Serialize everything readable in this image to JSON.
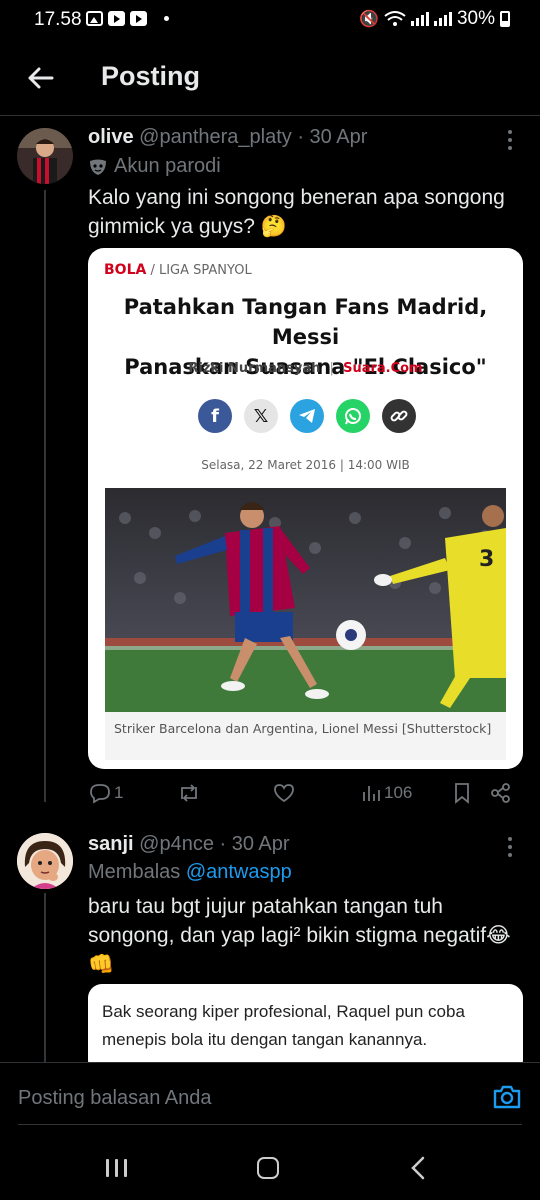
{
  "status_bar": {
    "time": "17.58",
    "battery": "30%"
  },
  "header": {
    "title": "Posting"
  },
  "tweet1": {
    "name": "olive",
    "handle": "@panthera_platy",
    "date": "· 30 Apr",
    "parody_label": "Akun parodi",
    "text": "Kalo yang ini songong beneran apa songong gimmick ya guys? 🤔",
    "card": {
      "section": "BOLA",
      "subsection": "/ LIGA SPANYOL",
      "headline_line1": "Patahkan Tangan Fans Madrid, Messi",
      "headline_line2": "Panaskan Suasana \"El Clasico\"",
      "author": "Rizki Nurmansyah",
      "separator": "|",
      "site": "Suara.Com",
      "dateline": "Selasa, 22 Maret 2016 | 14:00 WIB",
      "caption": "Striker Barcelona dan Argentina, Lionel Messi [Shutterstock]",
      "share_icons": [
        "facebook-icon",
        "x-icon",
        "telegram-icon",
        "whatsapp-icon",
        "link-icon"
      ],
      "colors": {
        "facebook": "#3b5998",
        "x": "#e5e5e5",
        "telegram": "#2aa3e0",
        "whatsapp": "#25d366",
        "link": "#333333"
      }
    },
    "actions": {
      "replies": "1",
      "retweets": "",
      "likes": "",
      "views": "106"
    }
  },
  "tweet2": {
    "name": "sanji",
    "handle": "@p4nce",
    "date": "· 30 Apr",
    "reply_prefix": "Membalas",
    "reply_mention": "@antwaspp",
    "text": "baru tau bgt jujur patahkan tangan tuh songong, dan yap lagi² bikin stigma negatif😂👊",
    "quote_text": "Bak seorang kiper profesional, Raquel pun coba menepis bola itu dengan tangan kanannya."
  },
  "reply_bar": {
    "placeholder": "Posting balasan Anda"
  },
  "colors": {
    "accent": "#1d9bf0",
    "muted": "#71767b",
    "text": "#e7e9ea",
    "background": "#000000"
  }
}
